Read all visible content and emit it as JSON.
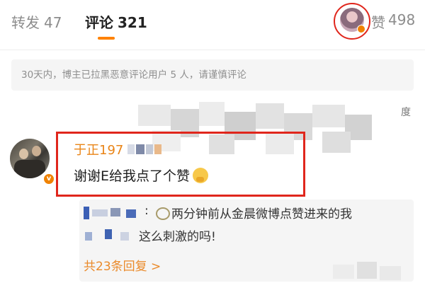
{
  "tabs": {
    "repost_label": "转发",
    "repost_count": "47",
    "comment_label": "评论",
    "comment_count": "321",
    "like_label": "赞",
    "like_count": "498",
    "active": "评论"
  },
  "notice": "30天内，博主已拉黑恶意评论用户 5 人，请谨慎评论",
  "header_suffix": "度",
  "comment": {
    "username": "于正197",
    "text": "谢谢E给我点了个赞"
  },
  "reply": {
    "colon": ":",
    "line1": "两分钟前从金晨微博点赞进来的我",
    "line2": "这么刺激的吗!",
    "more": "共23条回复 >"
  },
  "colors": {
    "accent": "#ff8200",
    "highlight_red": "#e0261c",
    "username": "#e98417"
  }
}
